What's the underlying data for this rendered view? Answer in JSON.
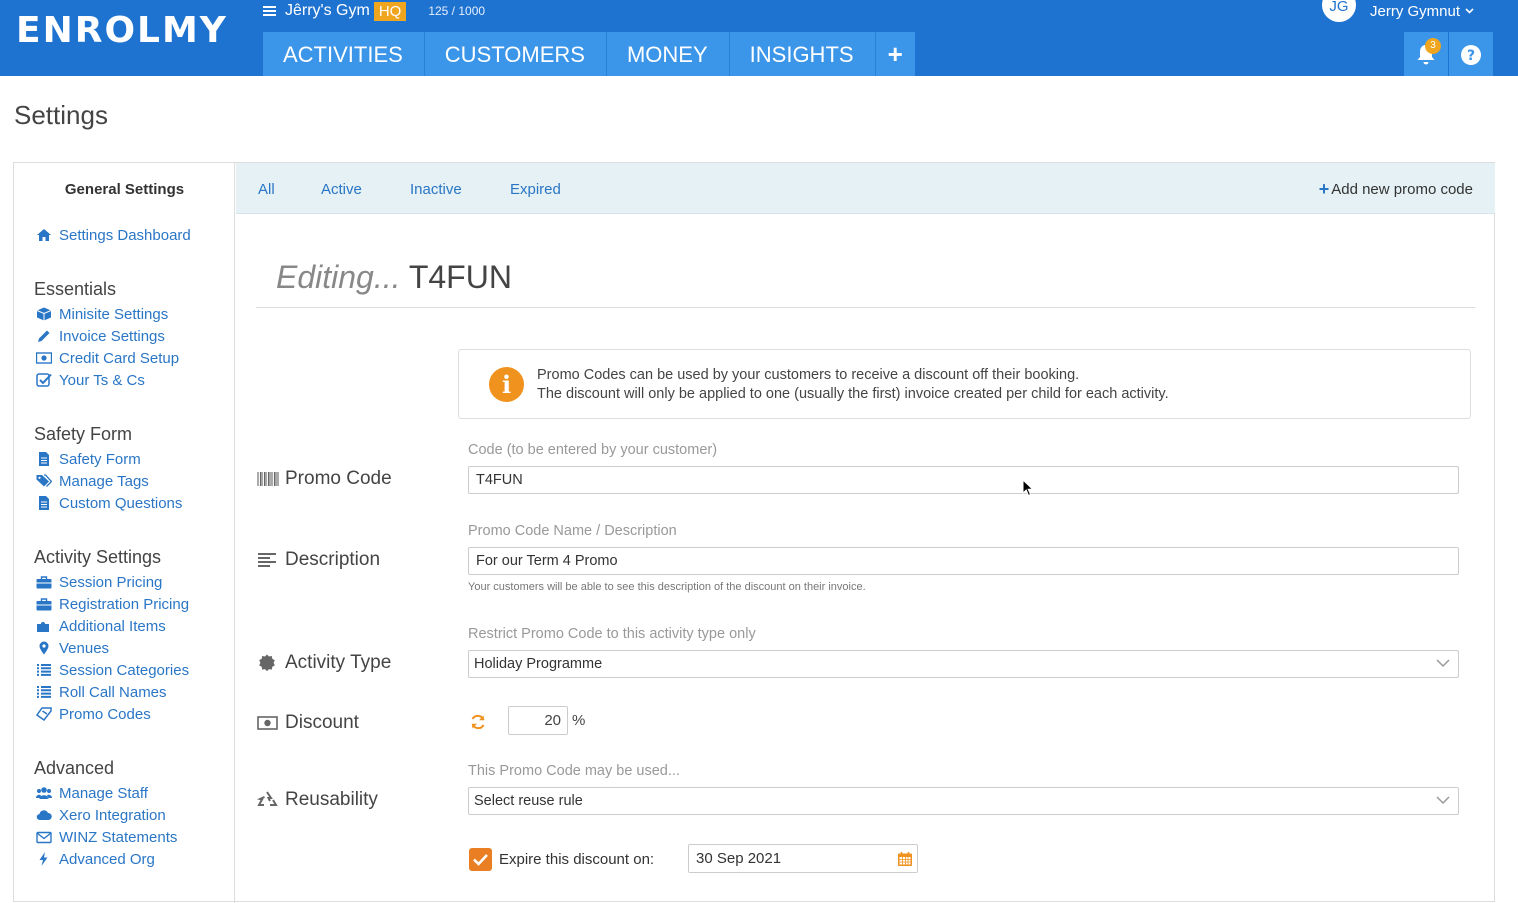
{
  "header": {
    "logo": "ENROLMY",
    "org_name": "Jêrry's Gym",
    "org_badge": "HQ",
    "usage": "125 / 1000",
    "user_initials": "JG",
    "user_name": "Jerry Gymnut",
    "notifications_count": "3",
    "nav": [
      "ACTIVITIES",
      "CUSTOMERS",
      "MONEY",
      "INSIGHTS"
    ],
    "nav_add": "+"
  },
  "page_title": "Settings",
  "sidebar": {
    "heading": "General Settings",
    "dashboard": "Settings Dashboard",
    "sections": [
      {
        "title": "Essentials",
        "items": [
          "Minisite Settings",
          "Invoice Settings",
          "Credit Card Setup",
          "Your Ts & Cs"
        ]
      },
      {
        "title": "Safety Form",
        "items": [
          "Safety Form",
          "Manage Tags",
          "Custom Questions"
        ]
      },
      {
        "title": "Activity Settings",
        "items": [
          "Session Pricing",
          "Registration Pricing",
          "Additional Items",
          "Venues",
          "Session Categories",
          "Roll Call Names",
          "Promo Codes"
        ]
      },
      {
        "title": "Advanced",
        "items": [
          "Manage Staff",
          "Xero Integration",
          "WINZ Statements",
          "Advanced Org"
        ]
      }
    ]
  },
  "filter_tabs": [
    "All",
    "Active",
    "Inactive",
    "Expired"
  ],
  "add_new_label": "Add new promo code",
  "editing": {
    "prefix": "Editing...",
    "code": "T4FUN"
  },
  "info": {
    "line1": "Promo Codes can be used by your customers to receive a discount off their booking.",
    "line2": "The discount will only be applied to one (usually the first) invoice created per child for each activity."
  },
  "form": {
    "promo_code": {
      "label": "Promo Code",
      "hint": "Code (to be entered by your customer)",
      "value": "T4FUN"
    },
    "description": {
      "label": "Description",
      "hint": "Promo Code Name / Description",
      "value": "For our Term 4 Promo",
      "help": "Your customers will be able to see this description of the discount on their invoice."
    },
    "activity_type": {
      "label": "Activity Type",
      "hint": "Restrict Promo Code to this activity type only",
      "value": "Holiday Programme"
    },
    "discount": {
      "label": "Discount",
      "value": "20",
      "unit": "%"
    },
    "reusability": {
      "label": "Reusability",
      "hint": "This Promo Code may be used...",
      "value": "Select reuse rule"
    },
    "expiry": {
      "checkbox_label": "Expire this discount on:",
      "checked": true,
      "date": "30 Sep 2021"
    }
  },
  "colors": {
    "header_blue": "#1f73d0",
    "nav_blue": "#3b95e8",
    "link_blue": "#2a76c6",
    "accent_orange": "#f0921e",
    "hq_badge": "#f0a51e"
  }
}
